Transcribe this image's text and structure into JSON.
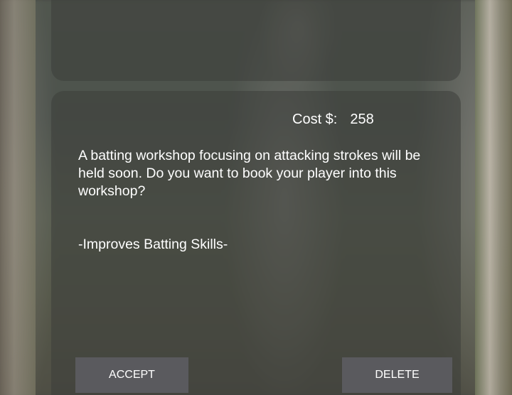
{
  "offer": {
    "cost_label": "Cost $:",
    "cost_value": "258",
    "description": "A batting workshop focusing on attacking strokes will be held soon. Do you want to book your player into this workshop?",
    "benefit": "-Improves Batting Skills-"
  },
  "actions": {
    "accept_label": "ACCEPT",
    "delete_label": "DELETE"
  },
  "colors": {
    "button_background": "#5a5a5e",
    "text": "#ffffff"
  }
}
